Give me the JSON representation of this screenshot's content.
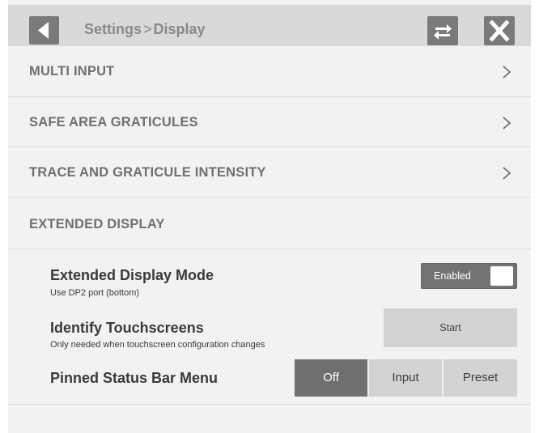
{
  "header": {
    "breadcrumb_root": "Settings",
    "breadcrumb_sep": ">",
    "breadcrumb_page": "Display"
  },
  "menu": [
    {
      "label": "MULTI INPUT"
    },
    {
      "label": "SAFE AREA GRATICULES"
    },
    {
      "label": "TRACE AND GRATICULE INTENSITY"
    },
    {
      "label": "EXTENDED DISPLAY"
    }
  ],
  "extended_display_mode": {
    "title": "Extended Display Mode",
    "subtitle": "Use DP2 port (bottom)",
    "toggle_label": "Enabled",
    "enabled": true
  },
  "identify_touchscreens": {
    "title": "Identify Touchscreens",
    "subtitle": "Only needed when touchscreen configuration changes",
    "button_label": "Start"
  },
  "pinned_status_bar": {
    "title": "Pinned Status Bar Menu",
    "options": [
      "Off",
      "Input",
      "Preset"
    ],
    "selected": "Off"
  },
  "icons": {
    "back": "back-arrow-icon",
    "swap": "swap-arrows-icon",
    "close": "close-x-icon",
    "chevron": "chevron-right-icon"
  },
  "colors": {
    "button_dark": "#7a7a7a",
    "active_segment": "#6f6f6f",
    "inactive_button": "#d3d3d3"
  }
}
